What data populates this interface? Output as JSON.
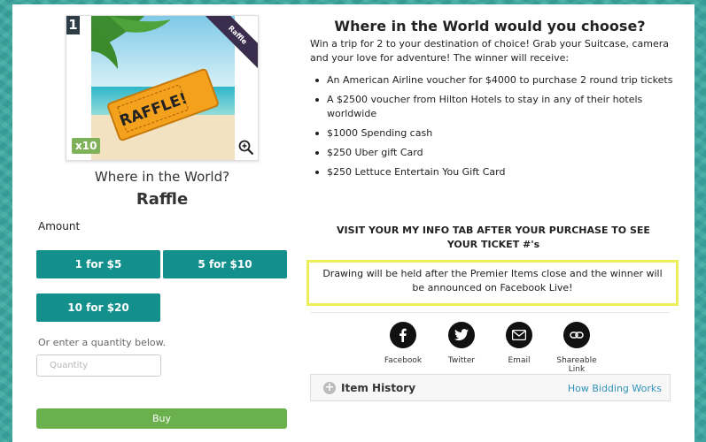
{
  "item": {
    "number": "1",
    "ribbon": "Raffle",
    "ticket_badge": "x10",
    "title": "Where in the World?",
    "type": "Raffle"
  },
  "purchase": {
    "amount_label": "Amount",
    "options": [
      "1 for $5",
      "5 for $10",
      "10 for $20"
    ],
    "quantity_hint": "Or enter a quantity below.",
    "quantity_placeholder": "Quantity",
    "buy_label": "Buy"
  },
  "description": {
    "heading": "Where in the World would you choose?",
    "intro": "Win a trip for 2 to your destination of choice! Grab your Suitcase, camera and your love for adventure! The winner will receive:",
    "prizes": [
      "An American Airline voucher for $4000 to purchase 2 round trip tickets",
      "A $2500 voucher from Hilton Hotels to stay in any of their hotels worldwide",
      "$1000 Spending cash",
      "$250 Uber gift Card",
      "$250 Lettuce Entertain You Gift Card"
    ],
    "notice": "VISIT YOUR MY INFO TAB AFTER YOUR PURCHASE TO SEE YOUR TICKET #'s",
    "drawing": "Drawing will be held after the Premier Items close and the winner will be announced on Facebook Live!"
  },
  "share": [
    {
      "label": "Facebook",
      "icon": "facebook-icon"
    },
    {
      "label": "Twitter",
      "icon": "twitter-icon"
    },
    {
      "label": "Email",
      "icon": "email-icon"
    },
    {
      "label": "Shareable Link",
      "icon": "link-icon"
    }
  ],
  "history": {
    "title": "Item History",
    "link": "How Bidding Works"
  },
  "colors": {
    "accent": "#138f8c",
    "buy": "#6ab04c",
    "highlight_border": "#eeee5a",
    "link": "#2f93b9"
  }
}
